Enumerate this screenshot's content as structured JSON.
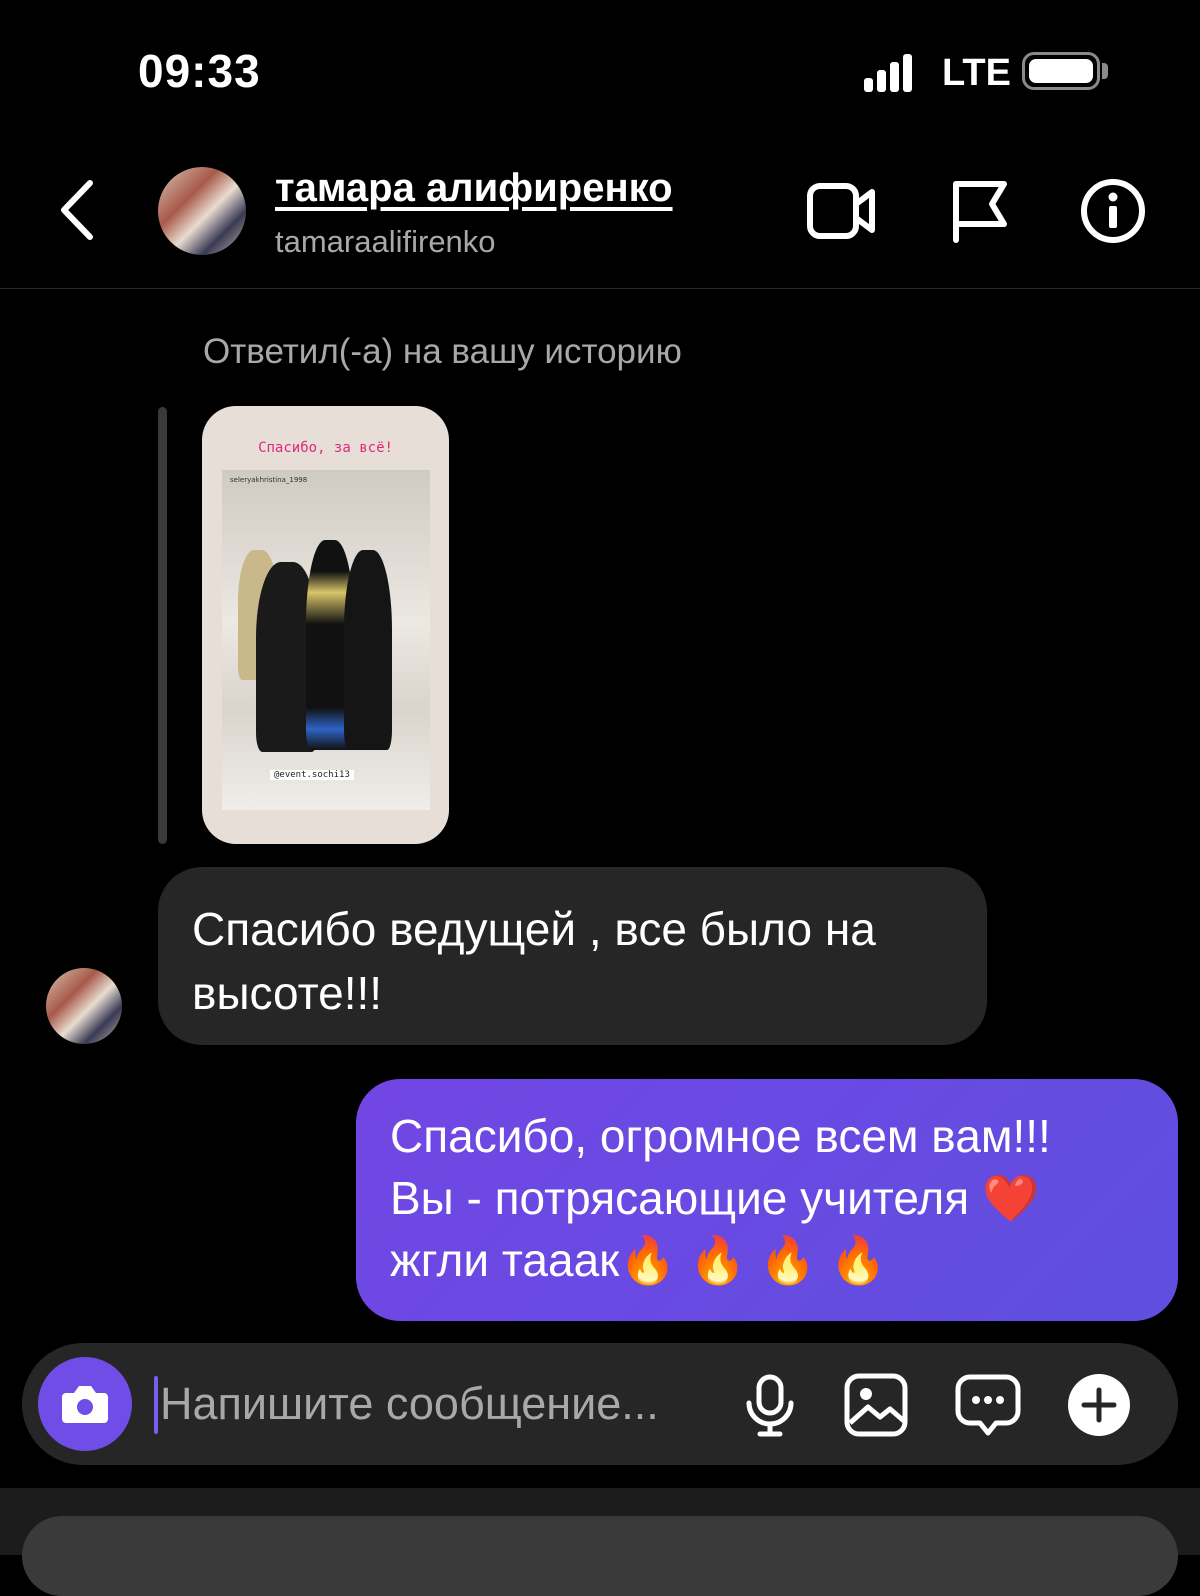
{
  "status_bar": {
    "time": "09:33",
    "network": "LTE",
    "battery_level": 1.0
  },
  "header": {
    "contact_name": "тамара алифиренко",
    "contact_username": "tamaraalifirenko",
    "icons": [
      "back-icon",
      "video-call-icon",
      "report-flag-icon",
      "info-icon"
    ]
  },
  "thread": {
    "reply_label": "Ответил(-а) на вашу историю",
    "story": {
      "title": "Спасибо, за всё!",
      "handle": "seleryakhristina_1998",
      "tag": "@event.sochi13"
    },
    "messages": [
      {
        "direction": "incoming",
        "text": "Спасибо ведущей , все было на высоте!!!"
      },
      {
        "direction": "outgoing",
        "line1": "Спасибо, огромное всем вам!!!",
        "line2": "Вы - потрясающие учителя",
        "line2_emoji": "❤️",
        "line3": "жгли тааак",
        "line3_emoji": "🔥 🔥 🔥 🔥"
      }
    ]
  },
  "composer": {
    "placeholder": "Напишите сообщение...",
    "accent": "#6f4de6",
    "icons": [
      "camera-icon",
      "microphone-icon",
      "gallery-icon",
      "chat-bubble-icon",
      "plus-icon"
    ]
  },
  "colors": {
    "outgoing_bubble": "#6a4ae2",
    "incoming_bubble": "#262626",
    "background": "#000000"
  }
}
